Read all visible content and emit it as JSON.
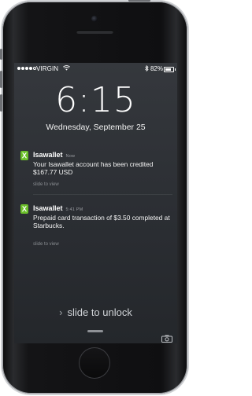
{
  "status_bar": {
    "carrier": "VIRGIN",
    "signal_dots_filled": 4,
    "signal_dots_total": 5,
    "wifi_icon": "wifi-icon",
    "bluetooth_icon": "bluetooth-icon",
    "battery_percent_text": "82%",
    "battery_level": 0.82
  },
  "lock_screen": {
    "time": "6:15",
    "date": "Wednesday, September 25"
  },
  "notifications": [
    {
      "app": "Isawallet",
      "time": "Now",
      "body": "Your Isawallet account has been credited $167.77 USD",
      "action": "slide to view"
    },
    {
      "app": "Isawallet",
      "time": "5:41 PM",
      "body": "Prepaid card transaction of $3.50 completed at Starbucks.",
      "action": "slide to view"
    }
  ],
  "unlock": {
    "text": "slide to unlock",
    "chevron_icon": "chevron-right-icon",
    "camera_icon": "camera-icon"
  },
  "colors": {
    "app_icon": "#6bbf2a",
    "screen_background": "#2b2e33"
  }
}
